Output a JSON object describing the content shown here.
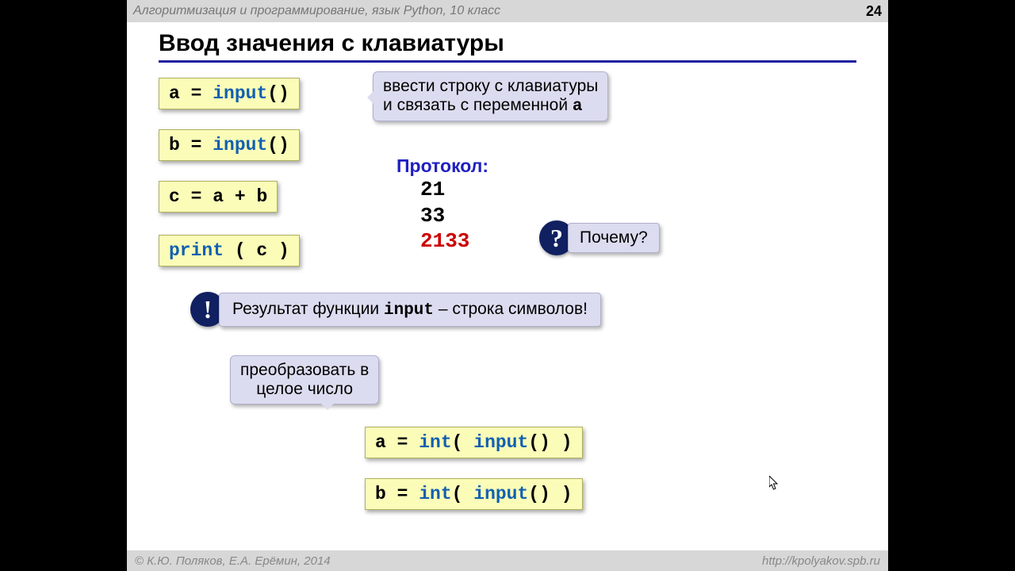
{
  "header": {
    "title": "Алгоритмизация и программирование, язык Python, 10 класс",
    "page": "24"
  },
  "title": "Ввод значения с клавиатуры",
  "code": {
    "a_assign": "a",
    "b_assign": "b",
    "c_assign": "c",
    "eq": " = ",
    "input_kw": "input",
    "parens": "()",
    "plus": "a + b",
    "print_kw": "print",
    "print_arg": " ( c )",
    "int_kw": "int",
    "int_call_open": "( ",
    "int_call_close": "() )"
  },
  "bubbles": {
    "desc_line1": "ввести строку с клавиатуры",
    "desc_line2": "и связать с переменной ",
    "desc_var": "a",
    "why": " Почему?",
    "result_pre": "Результат функции ",
    "result_func": "input",
    "result_post": " – строка символов!",
    "convert_line1": "преобразовать в",
    "convert_line2": "целое число"
  },
  "protocol": {
    "label": "Протокол:",
    "l1": "21",
    "l2": "33",
    "l3": "2133"
  },
  "icons": {
    "question": "?",
    "exclaim": "!"
  },
  "footer": {
    "left": "© К.Ю. Поляков, Е.А. Ерёмин, 2014",
    "right": "http://kpolyakov.spb.ru"
  }
}
